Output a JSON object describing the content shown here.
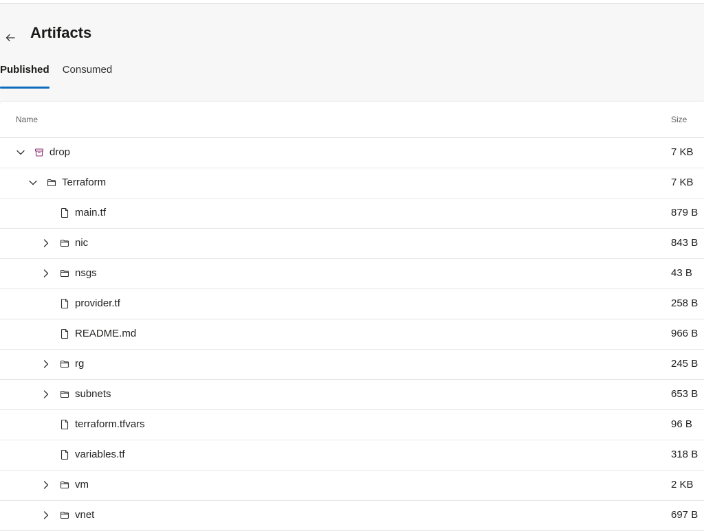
{
  "header": {
    "title": "Artifacts",
    "back_icon": "arrow-left-icon"
  },
  "tabs": [
    {
      "label": "Published",
      "active": true
    },
    {
      "label": "Consumed",
      "active": false
    }
  ],
  "table": {
    "columns": {
      "name": "Name",
      "size": "Size"
    },
    "rows": [
      {
        "name": "drop",
        "size": "7 KB",
        "type": "artifact",
        "depth": 0,
        "expander": "expanded"
      },
      {
        "name": "Terraform",
        "size": "7 KB",
        "type": "folder",
        "depth": 1,
        "expander": "expanded"
      },
      {
        "name": "main.tf",
        "size": "879 B",
        "type": "file",
        "depth": 2,
        "expander": "none"
      },
      {
        "name": "nic",
        "size": "843 B",
        "type": "folder",
        "depth": 2,
        "expander": "collapsed"
      },
      {
        "name": "nsgs",
        "size": "43 B",
        "type": "folder",
        "depth": 2,
        "expander": "collapsed"
      },
      {
        "name": "provider.tf",
        "size": "258 B",
        "type": "file",
        "depth": 2,
        "expander": "none"
      },
      {
        "name": "README.md",
        "size": "966 B",
        "type": "file",
        "depth": 2,
        "expander": "none"
      },
      {
        "name": "rg",
        "size": "245 B",
        "type": "folder",
        "depth": 2,
        "expander": "collapsed"
      },
      {
        "name": "subnets",
        "size": "653 B",
        "type": "folder",
        "depth": 2,
        "expander": "collapsed"
      },
      {
        "name": "terraform.tfvars",
        "size": "96 B",
        "type": "file",
        "depth": 2,
        "expander": "none"
      },
      {
        "name": "variables.tf",
        "size": "318 B",
        "type": "file",
        "depth": 2,
        "expander": "none"
      },
      {
        "name": "vm",
        "size": "2 KB",
        "type": "folder",
        "depth": 2,
        "expander": "collapsed"
      },
      {
        "name": "vnet",
        "size": "697 B",
        "type": "folder",
        "depth": 2,
        "expander": "collapsed"
      }
    ]
  },
  "colors": {
    "accent": "#0f6cbd",
    "artifact_icon": "#8a2b6e"
  }
}
